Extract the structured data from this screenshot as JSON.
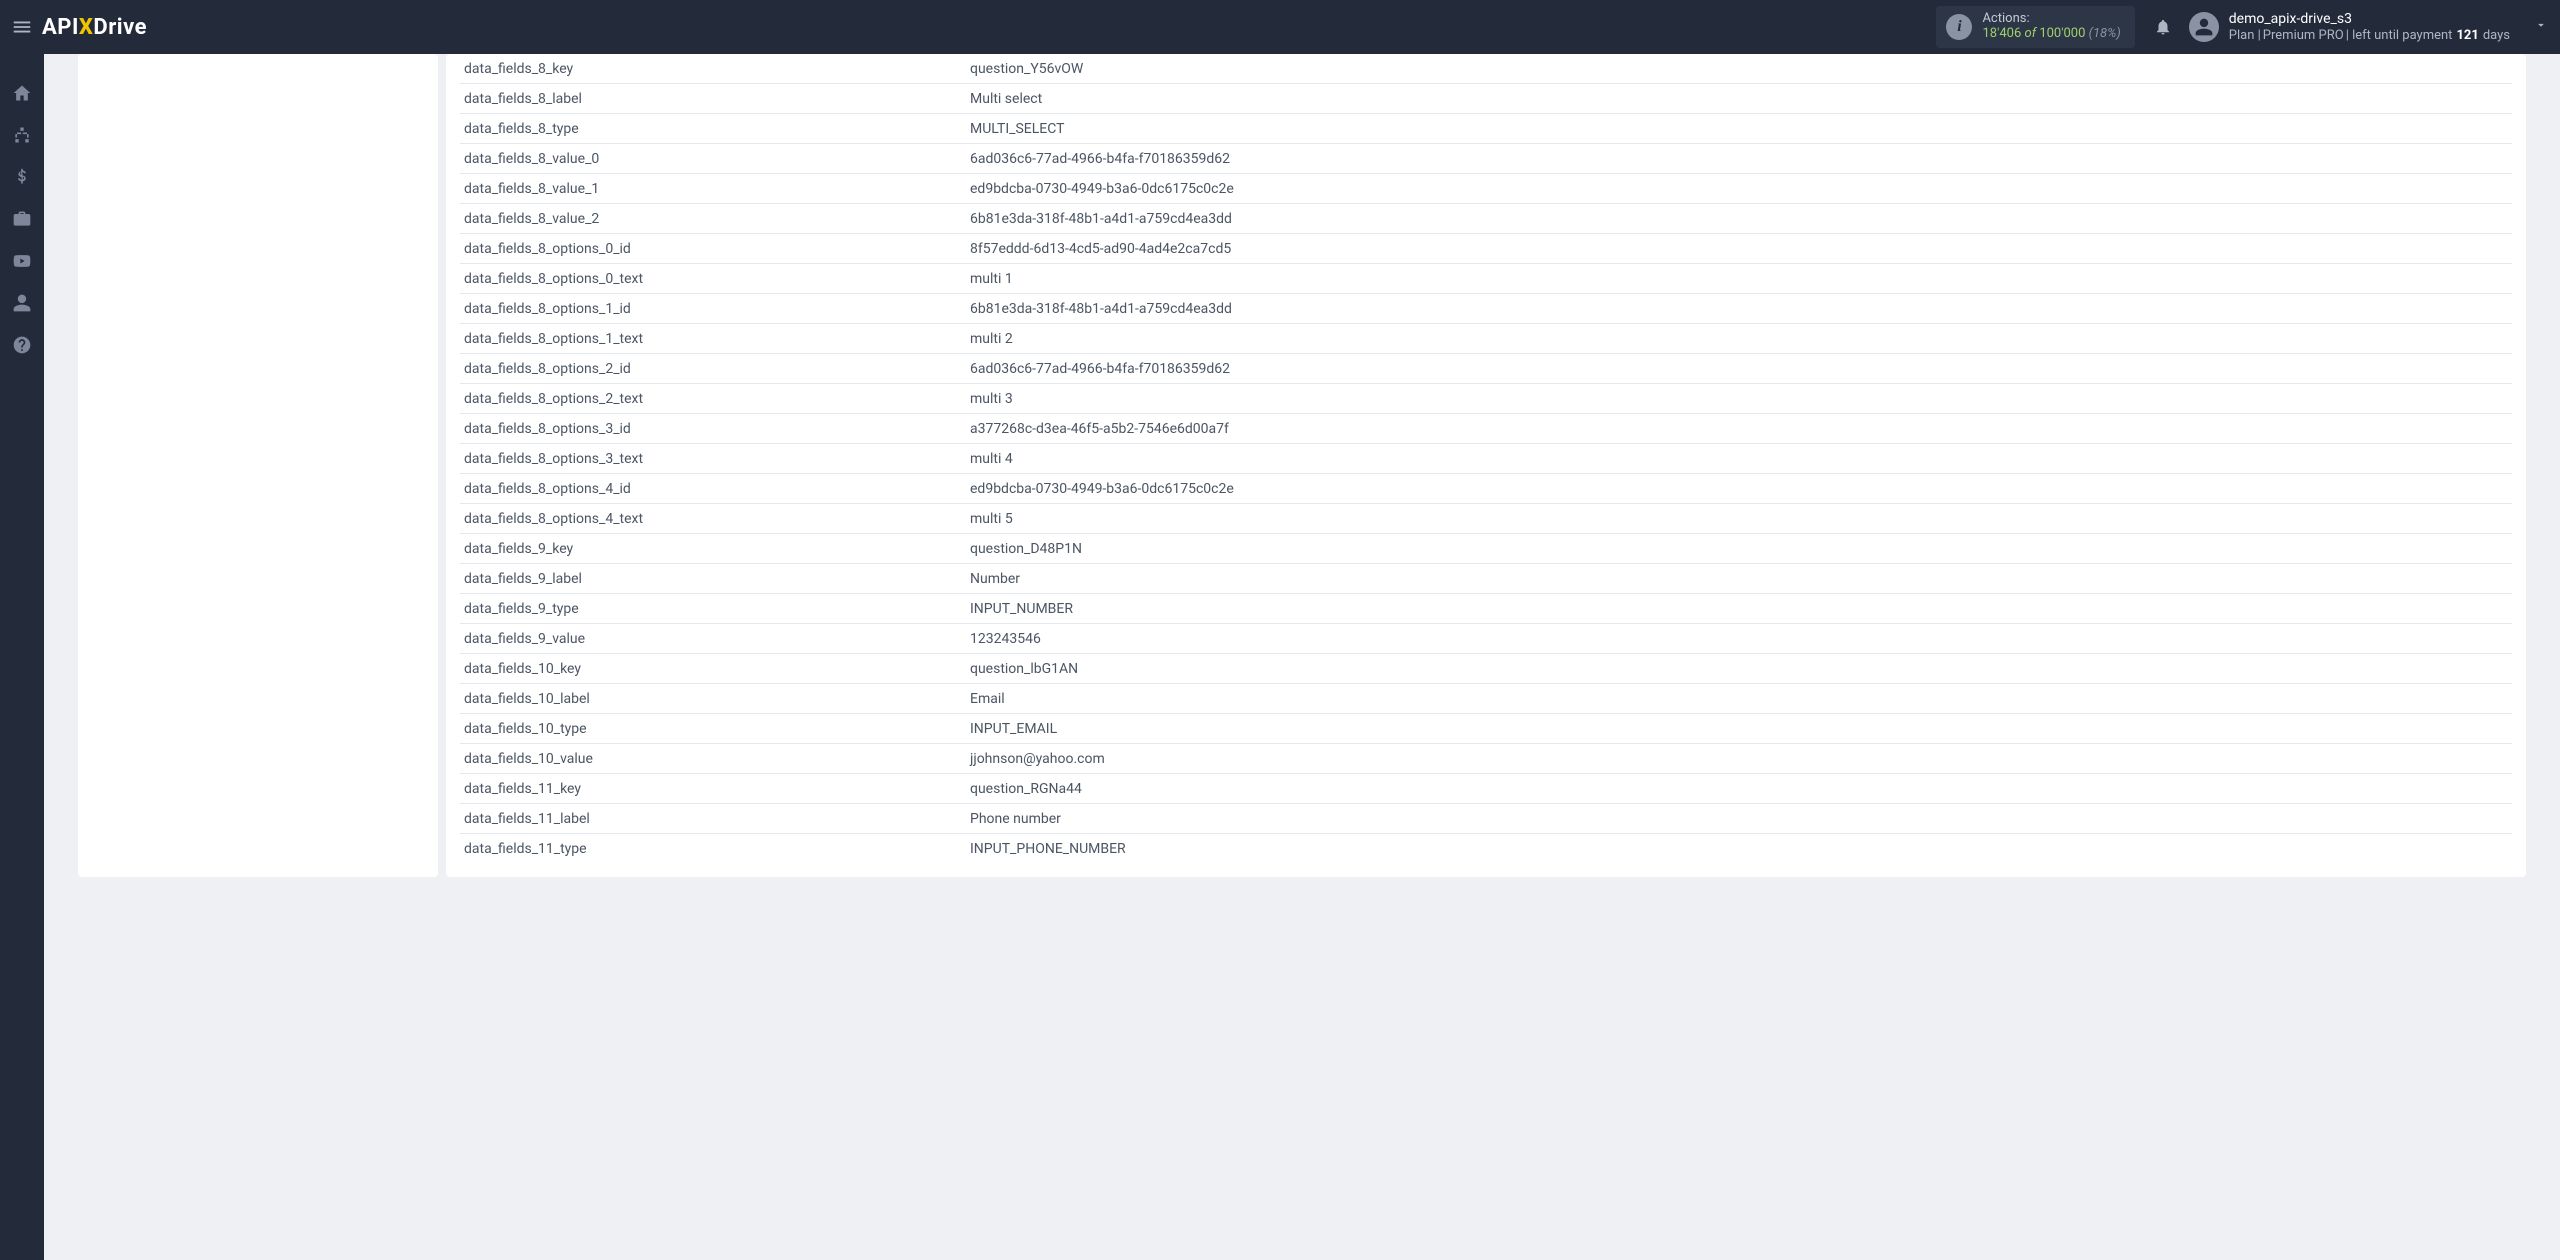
{
  "brand": {
    "part1": "API",
    "x": "X",
    "part2": "Drive"
  },
  "header": {
    "actions_label": "Actions:",
    "used": "18'406",
    "of_word": "of",
    "total": "100'000",
    "pct": "(18%)"
  },
  "user": {
    "name": "demo_apix-drive_s3",
    "plan_prefix": "Plan |",
    "plan_name": "Premium PRO",
    "plan_mid": "| left until payment",
    "days_num": "121",
    "days_word": "days"
  },
  "rows": [
    {
      "k": "data_fields_8_key",
      "v": "question_Y56vOW"
    },
    {
      "k": "data_fields_8_label",
      "v": "Multi select"
    },
    {
      "k": "data_fields_8_type",
      "v": "MULTI_SELECT"
    },
    {
      "k": "data_fields_8_value_0",
      "v": "6ad036c6-77ad-4966-b4fa-f70186359d62"
    },
    {
      "k": "data_fields_8_value_1",
      "v": "ed9bdcba-0730-4949-b3a6-0dc6175c0c2e"
    },
    {
      "k": "data_fields_8_value_2",
      "v": "6b81e3da-318f-48b1-a4d1-a759cd4ea3dd"
    },
    {
      "k": "data_fields_8_options_0_id",
      "v": "8f57eddd-6d13-4cd5-ad90-4ad4e2ca7cd5"
    },
    {
      "k": "data_fields_8_options_0_text",
      "v": "multi 1"
    },
    {
      "k": "data_fields_8_options_1_id",
      "v": "6b81e3da-318f-48b1-a4d1-a759cd4ea3dd"
    },
    {
      "k": "data_fields_8_options_1_text",
      "v": "multi 2"
    },
    {
      "k": "data_fields_8_options_2_id",
      "v": "6ad036c6-77ad-4966-b4fa-f70186359d62"
    },
    {
      "k": "data_fields_8_options_2_text",
      "v": "multi 3"
    },
    {
      "k": "data_fields_8_options_3_id",
      "v": "a377268c-d3ea-46f5-a5b2-7546e6d00a7f"
    },
    {
      "k": "data_fields_8_options_3_text",
      "v": "multi 4"
    },
    {
      "k": "data_fields_8_options_4_id",
      "v": "ed9bdcba-0730-4949-b3a6-0dc6175c0c2e"
    },
    {
      "k": "data_fields_8_options_4_text",
      "v": "multi 5"
    },
    {
      "k": "data_fields_9_key",
      "v": "question_D48P1N"
    },
    {
      "k": "data_fields_9_label",
      "v": "Number"
    },
    {
      "k": "data_fields_9_type",
      "v": "INPUT_NUMBER"
    },
    {
      "k": "data_fields_9_value",
      "v": "123243546"
    },
    {
      "k": "data_fields_10_key",
      "v": "question_lbG1AN"
    },
    {
      "k": "data_fields_10_label",
      "v": "Email"
    },
    {
      "k": "data_fields_10_type",
      "v": "INPUT_EMAIL"
    },
    {
      "k": "data_fields_10_value",
      "v": "jjohnson@yahoo.com"
    },
    {
      "k": "data_fields_11_key",
      "v": "question_RGNa44"
    },
    {
      "k": "data_fields_11_label",
      "v": "Phone number"
    },
    {
      "k": "data_fields_11_type",
      "v": "INPUT_PHONE_NUMBER"
    }
  ]
}
